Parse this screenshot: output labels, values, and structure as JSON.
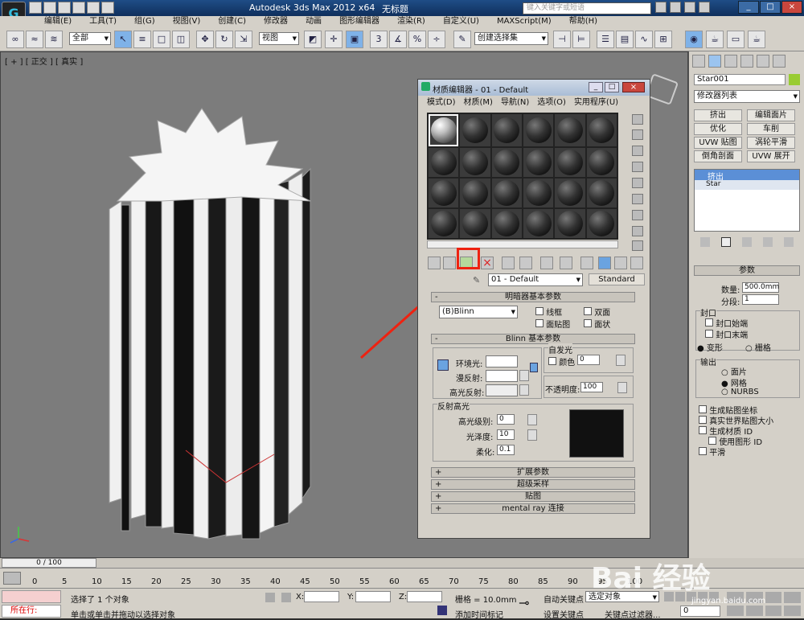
{
  "titlebar": {
    "app_title": "Autodesk 3ds Max  2012 x64",
    "doc_title": "无标题",
    "search_placeholder": "键入关键字或短语"
  },
  "menu": [
    "编辑(E)",
    "工具(T)",
    "组(G)",
    "视图(V)",
    "创建(C)",
    "修改器",
    "动画",
    "图形编辑器",
    "渲染(R)",
    "自定义(U)",
    "MAXScript(M)",
    "帮助(H)"
  ],
  "toolbar": {
    "filter": "全部",
    "ref_coord": "视图",
    "selection_set": "创建选择集",
    "angle_snap_label": "3",
    "pct_snap_label": "%"
  },
  "viewport": {
    "label": "[ + ] [ 正交 ] [ 真实 ]"
  },
  "mated": {
    "title": "材质编辑器 - 01 - Default",
    "menus": [
      "模式(D)",
      "材质(M)",
      "导航(N)",
      "选项(O)",
      "实用程序(U)"
    ],
    "material_name": "01 - Default",
    "material_type": "Standard",
    "shader_rollout": "明暗器基本参数",
    "shader": "(B)Blinn",
    "shader_opts": [
      "线框",
      "双面",
      "面贴图",
      "面状"
    ],
    "blinn_rollout": "Blinn 基本参数",
    "self_illum": "自发光",
    "color_label": "颜色",
    "self_illum_val": "0",
    "ambient": "环境光:",
    "diffuse": "漫反射:",
    "specular": "高光反射:",
    "opacity_label": "不透明度:",
    "opacity_val": "100",
    "spec_hl": "反射高光",
    "spec_level": "高光级别:",
    "spec_level_val": "0",
    "gloss": "光泽度:",
    "gloss_val": "10",
    "soften": "柔化:",
    "soften_val": "0.1",
    "collapsed": [
      "扩展参数",
      "超级采样",
      "贴图",
      "mental ray 连接"
    ]
  },
  "cmd": {
    "object_name": "Star001",
    "modifier_list": "修改器列表",
    "buttons": [
      "挤出",
      "编辑面片",
      "优化",
      "车削",
      "UVW 贴图",
      "涡轮平滑",
      "倒角剖面",
      "UVW 展开"
    ],
    "stack": [
      "挤出",
      "Star"
    ],
    "params_title": "参数",
    "amount_label": "数量:",
    "amount": "500.0mm",
    "segments_label": "分段:",
    "segments": "1",
    "cap_group": "封口",
    "cap_start": "封口始端",
    "cap_end": "封口末端",
    "morph": "变形",
    "grid": "栅格",
    "output_group": "输出",
    "out_patch": "面片",
    "out_mesh": "网格",
    "out_nurbs": "NURBS",
    "gen_map": "生成贴图坐标",
    "real_world": "真实世界贴图大小",
    "gen_mat": "生成材质 ID",
    "use_shape": "使用图形 ID",
    "smooth": "平滑"
  },
  "timeline": {
    "frame": "0 / 100",
    "ticks": [
      "0",
      "5",
      "10",
      "15",
      "20",
      "25",
      "30",
      "35",
      "40",
      "45",
      "50",
      "55",
      "60",
      "65",
      "70",
      "75",
      "80",
      "85",
      "90",
      "95",
      "100"
    ]
  },
  "status": {
    "running": "所在行:",
    "selected": "选择了 1 个对象",
    "hint": "单击或单击并拖动以选择对象",
    "x": "X:",
    "y": "Y:",
    "z": "Z:",
    "grid": "栅格 = 10.0mm",
    "add_time_tag": "添加时间标记",
    "auto_key": "自动关键点",
    "set_key": "设置关键点",
    "sel_obj": "选定对象",
    "key_filters": "关键点过滤器...",
    "frame_val": "0"
  },
  "watermark": {
    "text": "Bai  经验",
    "url": "jingyan.baidu.com"
  }
}
